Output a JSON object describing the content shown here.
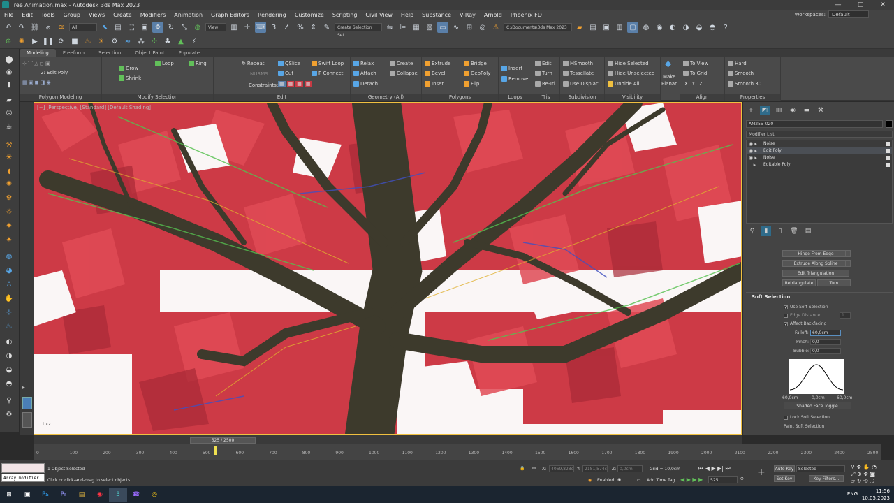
{
  "window": {
    "title": "Tree Animation.max - Autodesk 3ds Max 2023",
    "controls": [
      "—",
      "□",
      "✕"
    ]
  },
  "menu": {
    "items": [
      "File",
      "Edit",
      "Tools",
      "Group",
      "Views",
      "Create",
      "Modifiers",
      "Animation",
      "Graph Editors",
      "Rendering",
      "Customize",
      "Scripting",
      "Civil View",
      "Help",
      "Substance",
      "V-Ray",
      "Arnold",
      "Phoenix FD"
    ],
    "workspaces_label": "Workspaces:",
    "workspace_value": "Default"
  },
  "toolbar": {
    "selection_filter": "All",
    "ref_coord": "View",
    "named_selection": "Create Selection Set",
    "project_path": "C:\\Documents\\3ds Max 2023"
  },
  "ribbon": {
    "tabs": [
      "Modeling",
      "Freeform",
      "Selection",
      "Object Paint",
      "Populate"
    ],
    "active_tab": "Modeling",
    "groups": {
      "polygon_modeling": {
        "label": "Polygon Modeling",
        "sub_label": "2: Edit Poly"
      },
      "modify_selection": {
        "label": "Modify Selection",
        "grow": "Grow",
        "shrink": "Shrink",
        "loop": "Loop",
        "ring": "Ring"
      },
      "edit": {
        "label": "Edit",
        "repeat": "Repeat",
        "nurms": "NURMS",
        "constraints": "Constraints:",
        "qslice": "QSlice",
        "cut": "Cut",
        "swift_loop": "Swift Loop",
        "p_connect": "P Connect"
      },
      "geometry": {
        "label": "Geometry (All)",
        "relax": "Relax",
        "create": "Create",
        "attach": "Attach",
        "collapse": "Collapse",
        "detach": "Detach"
      },
      "polygons": {
        "label": "Polygons",
        "extrude": "Extrude",
        "bridge": "Bridge",
        "bevel": "Bevel",
        "geopoly": "GeoPoly",
        "inset": "Inset",
        "flip": "Flip"
      },
      "loops": {
        "label": "Loops",
        "insert": "Insert",
        "remove": "Remove"
      },
      "tris": {
        "label": "Tris",
        "edit": "Edit",
        "turn": "Turn",
        "retri": "Re-Tri"
      },
      "subdivision": {
        "label": "Subdivision",
        "msmooth": "MSmooth",
        "tessellate": "Tessellate",
        "use_displac": "Use Displac."
      },
      "visibility": {
        "label": "Visibility",
        "hide_selected": "Hide Selected",
        "hide_unselected": "Hide Unselected",
        "unhide_all": "Unhide All"
      },
      "make_planar": {
        "line1": "Make",
        "line2": "Planar"
      },
      "align": {
        "label": "Align",
        "to_view": "To View",
        "to_grid": "To Grid",
        "x": "X",
        "y": "Y",
        "z": "Z"
      },
      "properties": {
        "label": "Properties",
        "hard": "Hard",
        "smooth": "Smooth",
        "smooth30": "Smooth 30"
      }
    }
  },
  "viewport": {
    "label": "[+] [Perspective] [Standard] [Default Shading]"
  },
  "command_panel": {
    "object_name": "AM255_020",
    "modifier_list": "Modifier List",
    "stack": [
      {
        "name": "Noise",
        "selected": false
      },
      {
        "name": "Edit Poly",
        "selected": true
      },
      {
        "name": "Noise",
        "selected": false
      },
      {
        "name": "Editable Poly",
        "selected": false
      }
    ],
    "buttons": {
      "hinge": "Hinge From Edge",
      "extrude_spline": "Extrude Along Spline",
      "edit_tri": "Edit Triangulation",
      "retriangulate": "Retriangulate",
      "turn": "Turn"
    },
    "soft_selection": {
      "title": "Soft Selection",
      "use_soft": "Use Soft Selection",
      "edge_distance": "Edge Distance:",
      "edge_distance_val": "1",
      "affect_backfacing": "Affect Backfacing",
      "falloff_label": "Falloff:",
      "falloff": "60,0cm",
      "pinch_label": "Pinch:",
      "pinch": "0,0",
      "bubble_label": "Bubble:",
      "bubble": "0,0",
      "curve_labels": [
        "60,0cm",
        "0,0cm",
        "60,0cm"
      ],
      "shaded_face_toggle": "Shaded Face Toggle",
      "lock_soft": "Lock Soft Selection",
      "paint_soft": "Paint Soft Selection"
    }
  },
  "timeline": {
    "slider": "525 / 2500",
    "ticks": [
      "0",
      "100",
      "200",
      "300",
      "400",
      "500",
      "600",
      "700",
      "800",
      "900",
      "1000",
      "1100",
      "1200",
      "1300",
      "1400",
      "1500",
      "1600",
      "1700",
      "1800",
      "1900",
      "2000",
      "2100",
      "2200",
      "2300",
      "2400",
      "2500"
    ]
  },
  "status": {
    "maxscript_line": "Array modifier",
    "objects_selected": "1 Object Selected",
    "prompt": "Click or click-and-drag to select objects",
    "x_label": "X:",
    "x_val": "4069,828c",
    "y_label": "Y:",
    "y_val": "2181,574c",
    "z_label": "Z:",
    "z_val": "0,0cm",
    "grid": "Grid = 10,0cm",
    "enabled": "Enabled:",
    "add_time_tag": "Add Time Tag",
    "frame": "525",
    "auto_key": "Auto Key",
    "set_key": "Set Key",
    "selected": "Selected",
    "key_filters": "Key Filters..."
  },
  "taskbar": {
    "apps": [
      "⊞",
      "▣",
      "Ps",
      "Pr",
      "▤",
      "◉",
      "3",
      "☎",
      "◎"
    ],
    "lang": "ENG",
    "time": "11:56",
    "date": "10.05.2023"
  },
  "colors": {
    "accent": "#5a7fa8",
    "leaf": "#c83a44",
    "bark": "#3d3a2c",
    "viewport_border": "#f0c040"
  }
}
